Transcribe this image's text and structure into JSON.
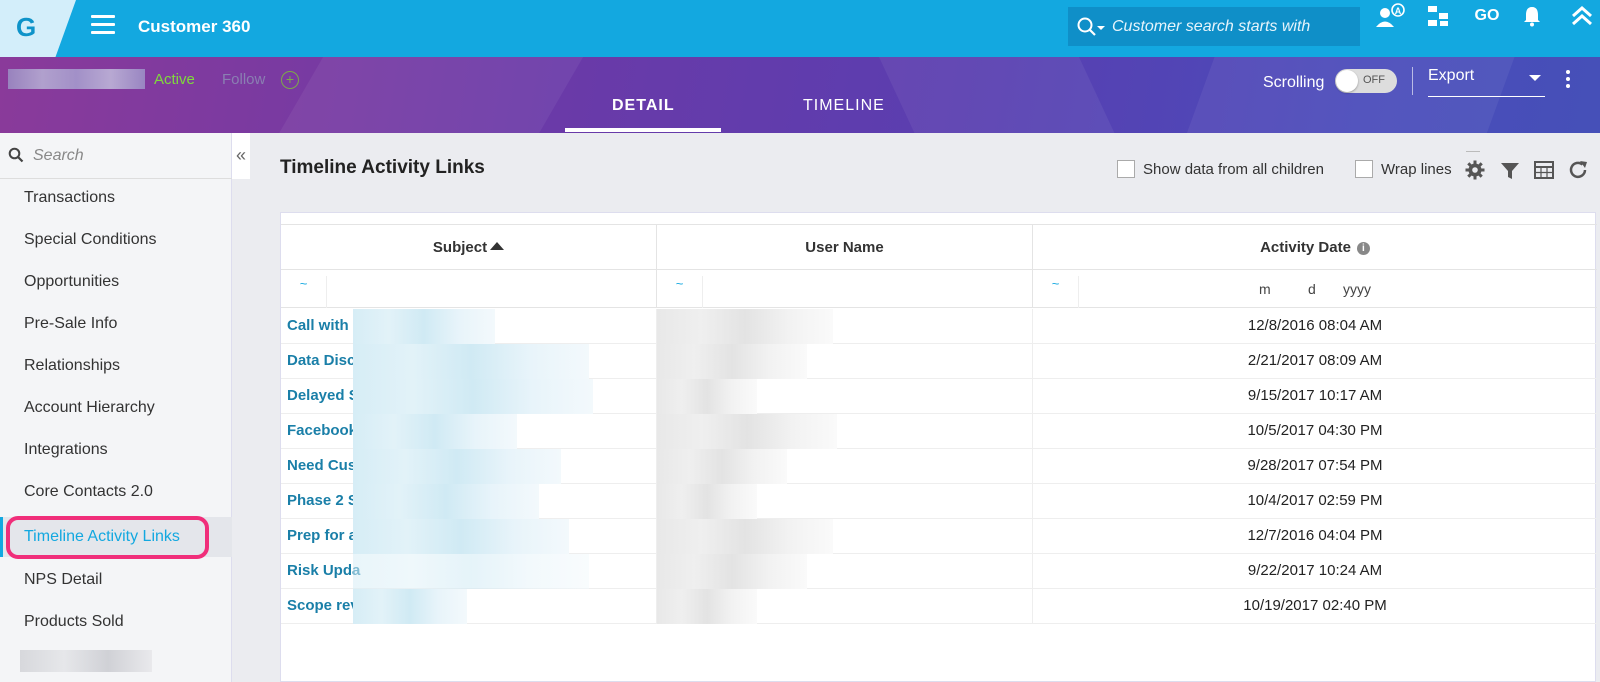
{
  "topbar": {
    "logo": "G",
    "app_title": "Customer 360",
    "search_placeholder": "Customer search starts with",
    "go_label": "GO"
  },
  "header": {
    "status": "Active",
    "follow_label": "Follow",
    "tabs": [
      {
        "label": "DETAIL",
        "active": true
      },
      {
        "label": "TIMELINE",
        "active": false
      }
    ],
    "scrolling_label": "Scrolling",
    "toggle_state": "OFF",
    "export_label": "Export"
  },
  "sidebar": {
    "search_placeholder": "Search",
    "items": [
      {
        "label": "Transactions"
      },
      {
        "label": "Special Conditions"
      },
      {
        "label": "Opportunities"
      },
      {
        "label": "Pre-Sale Info"
      },
      {
        "label": "Relationships"
      },
      {
        "label": "Account Hierarchy"
      },
      {
        "label": "Integrations"
      },
      {
        "label": "Core Contacts 2.0"
      },
      {
        "label": "Timeline Activity Links",
        "active": true
      },
      {
        "label": "NPS Detail"
      },
      {
        "label": "Products Sold"
      }
    ]
  },
  "main": {
    "title": "Timeline Activity Links",
    "show_children_label": "Show data from all children",
    "wrap_lines_label": "Wrap lines",
    "columns": [
      "Subject",
      "User Name",
      "Activity Date"
    ],
    "filter_tilde": "~",
    "date_placeholder": {
      "m": "m",
      "d": "d",
      "y": "yyyy"
    },
    "rows": [
      {
        "subject": "Call with",
        "date": "12/8/2016 08:04 AM"
      },
      {
        "subject": "Data Disc",
        "date": "2/21/2017 08:09 AM"
      },
      {
        "subject": "Delayed S",
        "date": "9/15/2017 10:17 AM"
      },
      {
        "subject": "Facebook",
        "date": "10/5/2017 04:30 PM"
      },
      {
        "subject": "Need Cus",
        "date": "9/28/2017 07:54 PM"
      },
      {
        "subject": "Phase 2 S",
        "date": "10/4/2017 02:59 PM"
      },
      {
        "subject": "Prep for a",
        "date": "12/7/2016 04:04 PM"
      },
      {
        "subject": "Risk Upda",
        "date": "9/22/2017 10:24 AM"
      },
      {
        "subject": "Scope rev",
        "date": "10/19/2017 02:40 PM"
      }
    ]
  },
  "colors": {
    "topbar": "#13a8e0",
    "accent": "#13a8e0",
    "active_status": "#7fd93c",
    "highlight": "#f02e7a"
  }
}
